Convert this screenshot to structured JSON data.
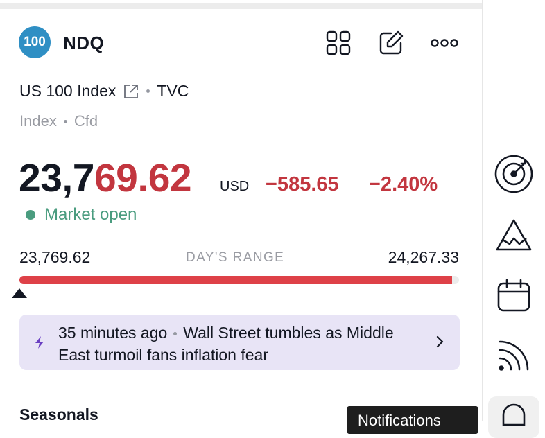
{
  "symbol": {
    "logo_text": "100",
    "ticker": "NDQ",
    "full_name": "US 100 Index",
    "exchange": "TVC",
    "type": "Index",
    "subtype": "Cfd"
  },
  "quote": {
    "price_part1": "23,7",
    "price_part2": "69.62",
    "currency": "USD",
    "change": "−585.65",
    "change_percent": "−2.40%",
    "status": "Market open"
  },
  "days_range": {
    "low": "23,769.62",
    "label": "DAY'S RANGE",
    "high": "24,267.33",
    "fill_fraction": 0.985,
    "marker_fraction": 0.0
  },
  "news": {
    "time": "35 minutes ago",
    "headline": "Wall Street tumbles as Middle East turmoil fans inflation fear"
  },
  "section": {
    "seasonals": "Seasonals"
  },
  "tooltip": {
    "notifications": "Notifications"
  },
  "icons": {
    "header": [
      "grid-icon",
      "edit-icon",
      "more-icon"
    ],
    "sidebar": [
      "target-icon",
      "ideas-icon",
      "calendar-icon",
      "signal-icon",
      "bell-icon"
    ]
  },
  "colors": {
    "negative": "#c2363f",
    "positive": "#4a9c7f",
    "logo": "#2f8fc4",
    "news_bg": "#e8e4f6",
    "range_fill": "#de4148"
  }
}
